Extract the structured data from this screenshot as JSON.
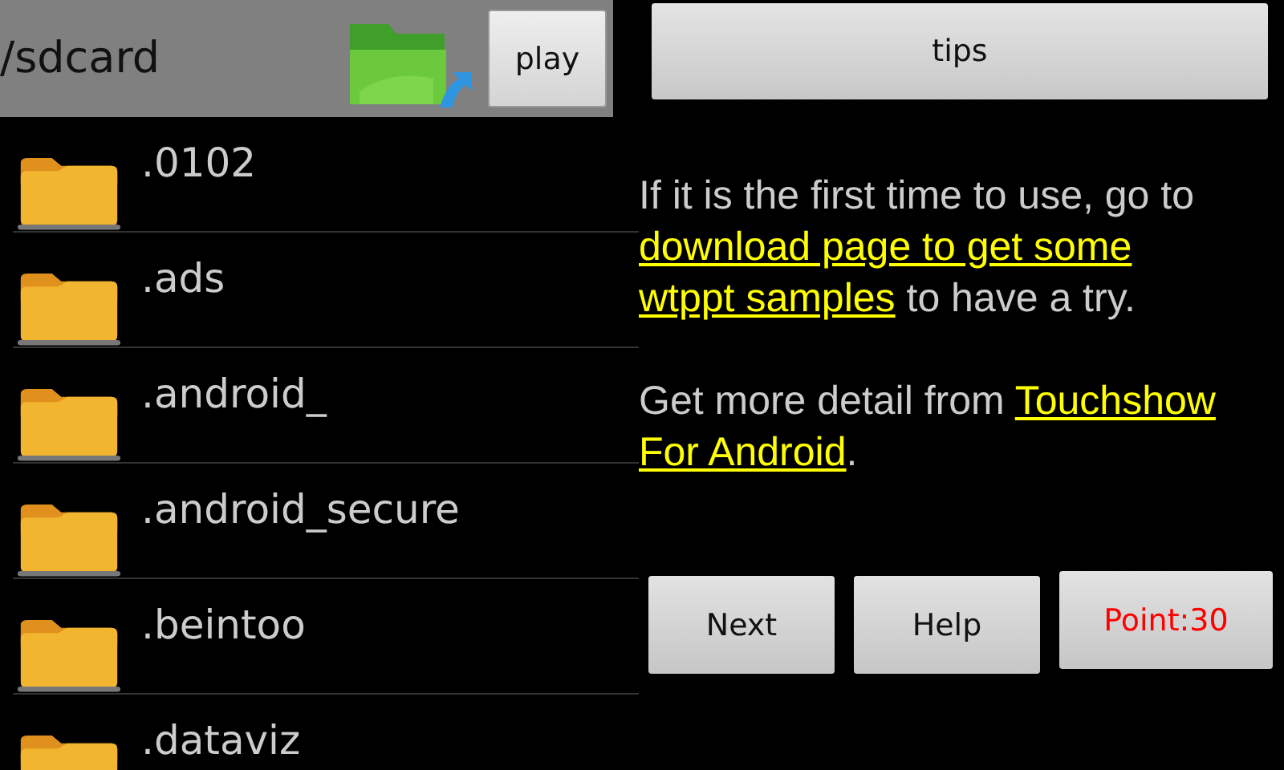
{
  "path_bar": {
    "path": "/sdcard",
    "button": "play"
  },
  "files": [
    {
      "name": ".0102"
    },
    {
      "name": ".ads"
    },
    {
      "name": ".android_"
    },
    {
      "name": ".android_secure"
    },
    {
      "name": ".beintoo"
    },
    {
      "name": ".dataviz"
    }
  ],
  "tips_button": "tips",
  "paragraphs": [
    [
      {
        "kind": "text",
        "text": "If it is the first time to use, go to "
      },
      {
        "kind": "link",
        "text": "download page to get some"
      },
      {
        "kind": "link",
        "text": "wtppt samples"
      },
      {
        "kind": "text",
        "text": " to have a try."
      }
    ],
    [
      {
        "kind": "text",
        "text": "Get more detail from "
      },
      {
        "kind": "link",
        "text": "Touchshow"
      },
      {
        "kind": "link",
        "text": "For Android"
      },
      {
        "kind": "text",
        "text": "."
      }
    ]
  ],
  "buttons": [
    {
      "label": "Next",
      "kind": "plain"
    },
    {
      "label": "Help",
      "kind": "plain"
    },
    {
      "label": "Point:30",
      "kind": "alert"
    }
  ]
}
